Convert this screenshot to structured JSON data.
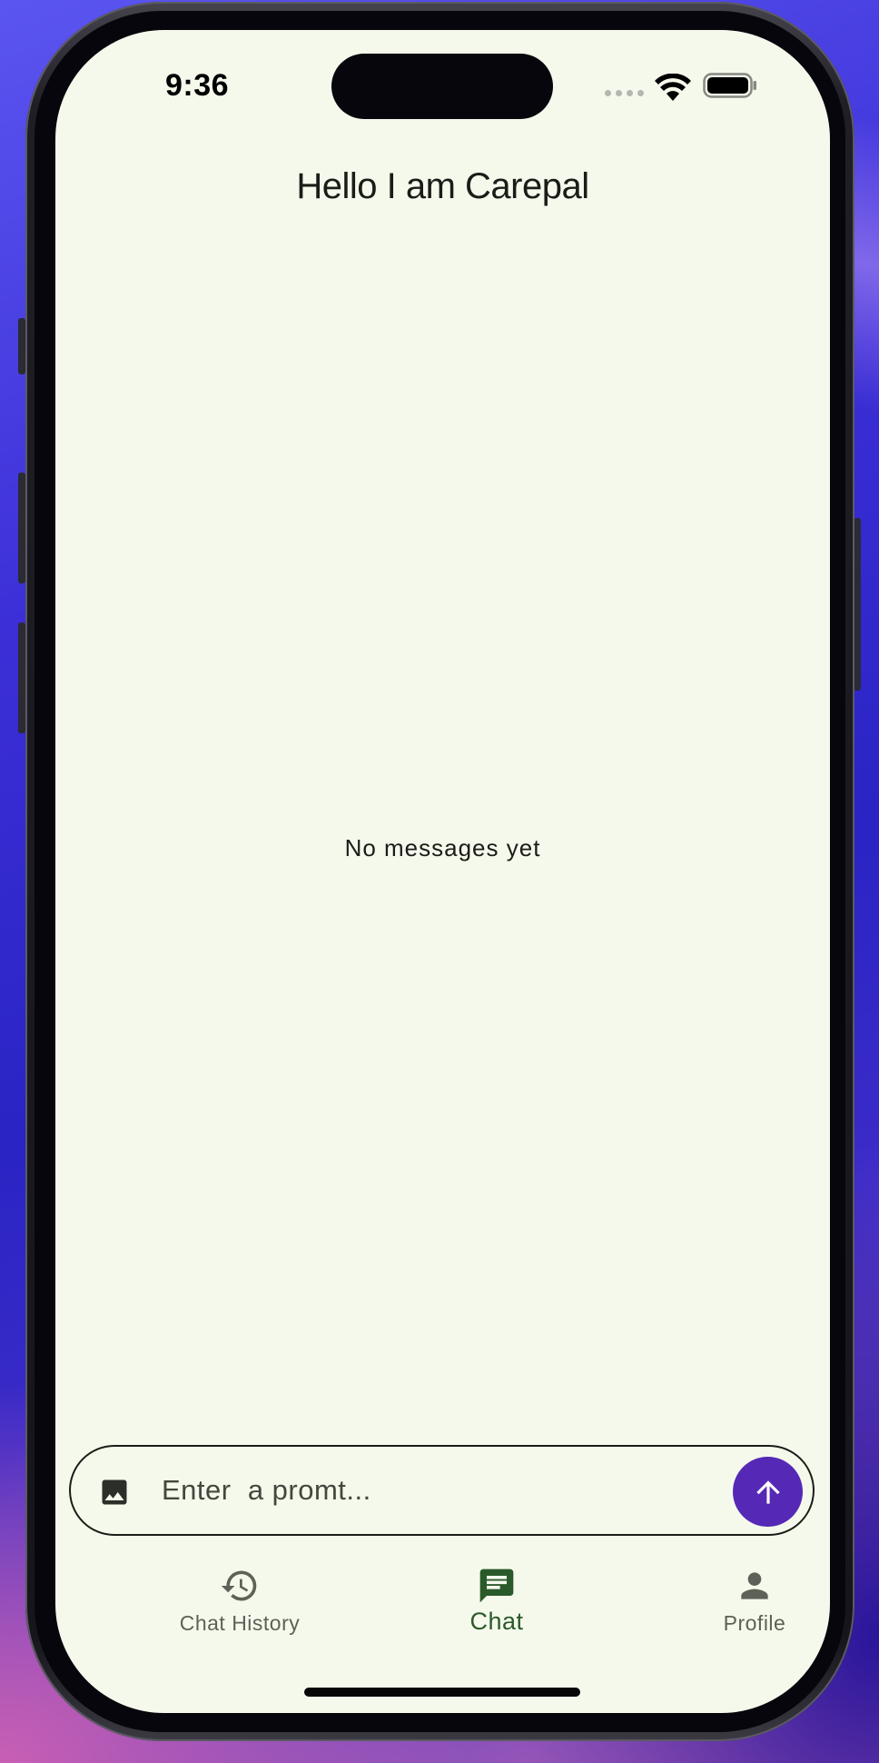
{
  "status_bar": {
    "time": "9:36"
  },
  "header": {
    "title": "Hello I am Carepal"
  },
  "chat": {
    "empty_message": "No messages yet"
  },
  "composer": {
    "placeholder": "Enter  a promt...",
    "attach_icon": "image-icon",
    "send_icon": "arrow-up-icon"
  },
  "bottom_nav": {
    "items": [
      {
        "label": "Chat History",
        "icon": "history-icon",
        "active": false
      },
      {
        "label": "Chat",
        "icon": "chat-icon",
        "active": true
      },
      {
        "label": "Profile",
        "icon": "person-icon",
        "active": false
      }
    ]
  },
  "colors": {
    "screen_background": "#f5f9ec",
    "send_button": "#5529b6",
    "active_nav": "#2b5a2a",
    "inactive_nav": "#5d6158"
  }
}
